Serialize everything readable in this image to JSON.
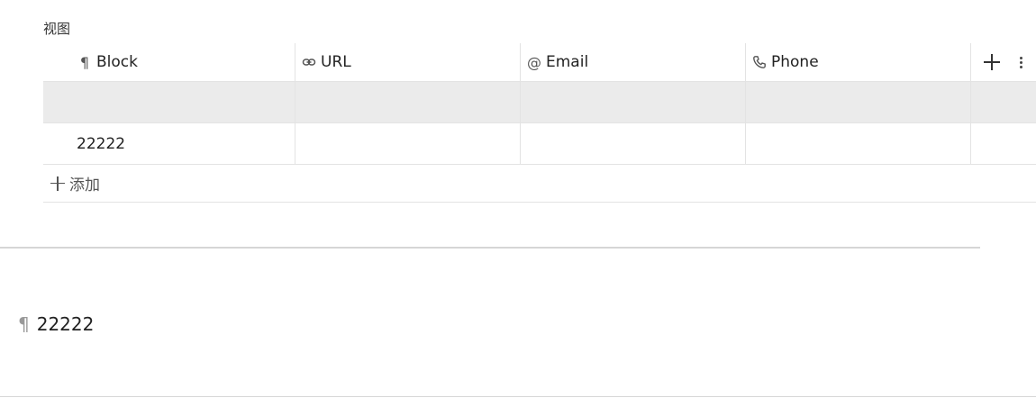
{
  "view": {
    "title": "视图"
  },
  "table": {
    "columns": [
      {
        "icon": "pilcrow-icon",
        "glyph": "¶",
        "label": "Block"
      },
      {
        "icon": "link-icon",
        "glyph": "",
        "label": "URL"
      },
      {
        "icon": "at-icon",
        "glyph": "@",
        "label": "Email"
      },
      {
        "icon": "phone-icon",
        "glyph": "",
        "label": "Phone"
      }
    ],
    "rows": [
      {
        "block": "",
        "url": "",
        "email": "",
        "phone": ""
      },
      {
        "block": "22222",
        "url": "",
        "email": "",
        "phone": ""
      }
    ],
    "add_label": "添加"
  },
  "paragraph": {
    "icon": "pilcrow-icon",
    "glyph": "¶",
    "text": "22222"
  }
}
